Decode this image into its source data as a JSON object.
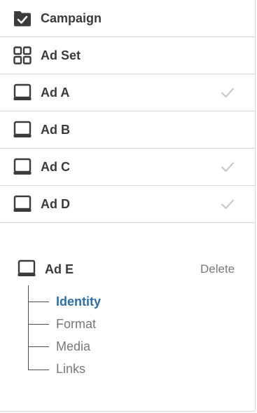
{
  "nav": {
    "items": [
      {
        "label": "Campaign",
        "icon": "folder-check-icon",
        "checked": false
      },
      {
        "label": "Ad Set",
        "icon": "grid-icon",
        "checked": false
      },
      {
        "label": "Ad A",
        "icon": "laptop-icon",
        "checked": true
      },
      {
        "label": "Ad B",
        "icon": "laptop-icon",
        "checked": false
      },
      {
        "label": "Ad C",
        "icon": "laptop-icon",
        "checked": true
      },
      {
        "label": "Ad D",
        "icon": "laptop-icon",
        "checked": true
      }
    ]
  },
  "editing": {
    "title": "Ad E",
    "icon": "laptop-icon",
    "delete_label": "Delete",
    "steps": [
      {
        "label": "Identity",
        "active": true
      },
      {
        "label": "Format",
        "active": false
      },
      {
        "label": "Media",
        "active": false
      },
      {
        "label": "Links",
        "active": false
      }
    ]
  },
  "colors": {
    "text": "#3b3b3b",
    "muted": "#777777",
    "active_step": "#2f6ea8",
    "check": "#c4c4c4",
    "divider": "#d6d6d6"
  }
}
